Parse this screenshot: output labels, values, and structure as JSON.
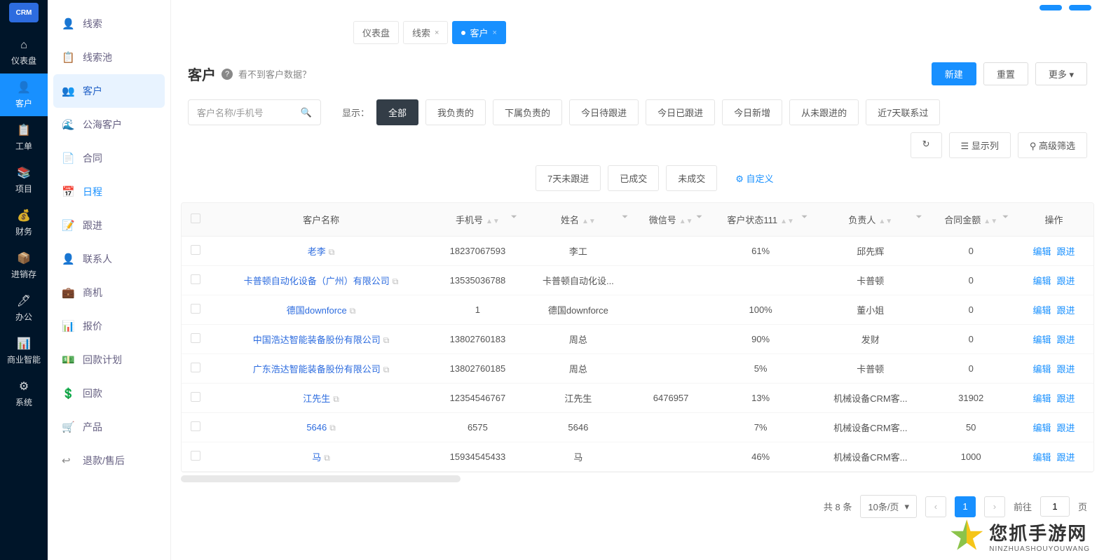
{
  "rail": {
    "logo": "CRM",
    "items": [
      {
        "icon": "⌂",
        "label": "仪表盘"
      },
      {
        "icon": "👤",
        "label": "客户"
      },
      {
        "icon": "📋",
        "label": "工单"
      },
      {
        "icon": "📚",
        "label": "项目"
      },
      {
        "icon": "💰",
        "label": "财务"
      },
      {
        "icon": "📦",
        "label": "进销存"
      },
      {
        "icon": "🖊",
        "label": "办公"
      },
      {
        "icon": "📊",
        "label": "商业智能"
      },
      {
        "icon": "⚙",
        "label": "系统"
      }
    ]
  },
  "sidebar": {
    "items": [
      {
        "icon": "👤",
        "label": "线索"
      },
      {
        "icon": "📋",
        "label": "线索池"
      },
      {
        "icon": "👥",
        "label": "客户"
      },
      {
        "icon": "🌊",
        "label": "公海客户"
      },
      {
        "icon": "📄",
        "label": "合同"
      },
      {
        "icon": "📅",
        "label": "日程"
      },
      {
        "icon": "📝",
        "label": "跟进"
      },
      {
        "icon": "👤",
        "label": "联系人"
      },
      {
        "icon": "💼",
        "label": "商机"
      },
      {
        "icon": "📊",
        "label": "报价"
      },
      {
        "icon": "💵",
        "label": "回款计划"
      },
      {
        "icon": "💲",
        "label": "回款"
      },
      {
        "icon": "🛒",
        "label": "产品"
      },
      {
        "icon": "↩",
        "label": "退款/售后"
      }
    ]
  },
  "tabs": [
    {
      "label": "仪表盘"
    },
    {
      "label": "线索"
    },
    {
      "label": "客户"
    }
  ],
  "page": {
    "title": "客户",
    "hint": "看不到客户数据？",
    "new": "新建",
    "reset": "重置",
    "more": "更多"
  },
  "search": {
    "placeholder": "客户名称/手机号"
  },
  "filterLabel": "显示：",
  "chips": [
    "全部",
    "我负责的",
    "下属负责的",
    "今日待跟进",
    "今日已跟进",
    "今日新增",
    "从未跟进的",
    "近7天联系过"
  ],
  "chips2": [
    "7天未跟进",
    "已成交",
    "未成交"
  ],
  "custom": "自定义",
  "rightFilters": {
    "display": "显示列",
    "advanced": "高级筛选"
  },
  "columns": [
    "客户名称",
    "手机号",
    "姓名",
    "微信号",
    "客户状态111",
    "负责人",
    "合同金额",
    "操作"
  ],
  "rows": [
    {
      "name": "老李",
      "phone": "18237067593",
      "contact": "李工",
      "wx": "",
      "status": "61%",
      "owner": "邱先辉",
      "amount": "0"
    },
    {
      "name": "卡普顿自动化设备（广州）有限公司",
      "phone": "13535036788",
      "contact": "卡普顿自动化设...",
      "wx": "",
      "status": "",
      "owner": "卡普顿",
      "amount": "0"
    },
    {
      "name": "德国downforce",
      "phone": "1",
      "contact": "德国downforce",
      "wx": "",
      "status": "100%",
      "owner": "董小姐",
      "amount": "0"
    },
    {
      "name": "中国浩达智能装备股份有限公司",
      "phone": "13802760183",
      "contact": "周总",
      "wx": "",
      "status": "90%",
      "owner": "发财",
      "amount": "0"
    },
    {
      "name": "广东浩达智能装备股份有限公司",
      "phone": "13802760185",
      "contact": "周总",
      "wx": "",
      "status": "5%",
      "owner": "卡普顿",
      "amount": "0"
    },
    {
      "name": "江先生",
      "phone": "12354546767",
      "contact": "江先生",
      "wx": "6476957",
      "status": "13%",
      "owner": "机械设备CRM客...",
      "amount": "31902"
    },
    {
      "name": "5646",
      "phone": "6575",
      "contact": "5646",
      "wx": "",
      "status": "7%",
      "owner": "机械设备CRM客...",
      "amount": "50"
    },
    {
      "name": "马",
      "phone": "15934545433",
      "contact": "马",
      "wx": "",
      "status": "46%",
      "owner": "机械设备CRM客...",
      "amount": "1000"
    }
  ],
  "actions": {
    "edit": "编辑",
    "follow": "跟进"
  },
  "pagination": {
    "total": "共 8 条",
    "perPage": "10条/页",
    "page": "1",
    "goto": "前往",
    "pageSuffix": "页"
  },
  "watermark": {
    "cn": "您抓手游网",
    "py": "NINZHUASHOUYOUWANG"
  }
}
